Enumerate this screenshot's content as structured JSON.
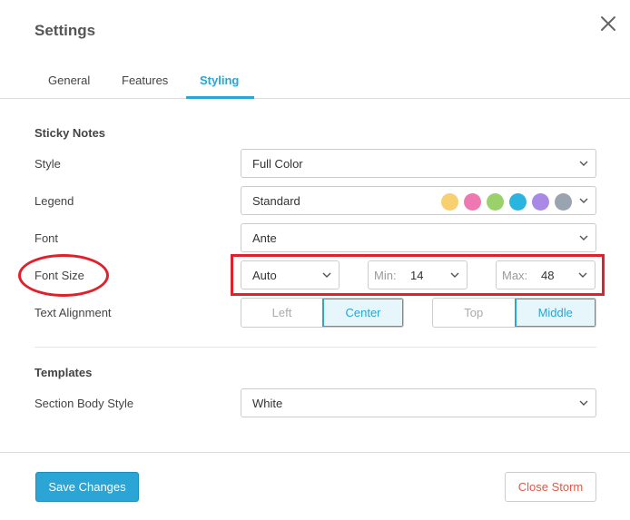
{
  "dialog": {
    "title": "Settings"
  },
  "tabs": [
    {
      "label": "General",
      "active": false
    },
    {
      "label": "Features",
      "active": false
    },
    {
      "label": "Styling",
      "active": true
    }
  ],
  "sticky_notes": {
    "section_title": "Sticky Notes",
    "style": {
      "label": "Style",
      "value": "Full Color"
    },
    "legend": {
      "label": "Legend",
      "value": "Standard",
      "colors": [
        "#f7d070",
        "#ef78b0",
        "#9bd16a",
        "#2ab4e0",
        "#a88ae6",
        "#9aa4b0"
      ]
    },
    "font": {
      "label": "Font",
      "value": "Ante"
    },
    "font_size": {
      "label": "Font Size",
      "mode": "Auto",
      "min_prefix": "Min:",
      "min_value": "14",
      "max_prefix": "Max:",
      "max_value": "48"
    },
    "text_alignment": {
      "label": "Text Alignment",
      "horizontal": [
        {
          "label": "Left",
          "active": false
        },
        {
          "label": "Center",
          "active": true
        }
      ],
      "vertical": [
        {
          "label": "Top",
          "active": false
        },
        {
          "label": "Middle",
          "active": true
        }
      ]
    }
  },
  "templates": {
    "section_title": "Templates",
    "section_body_style": {
      "label": "Section Body Style",
      "value": "White"
    }
  },
  "footer": {
    "save_label": "Save Changes",
    "close_label": "Close Storm"
  },
  "colors": {
    "accent": "#2aa5d6",
    "danger": "#e05a4a",
    "annotation": "#e0202a"
  }
}
